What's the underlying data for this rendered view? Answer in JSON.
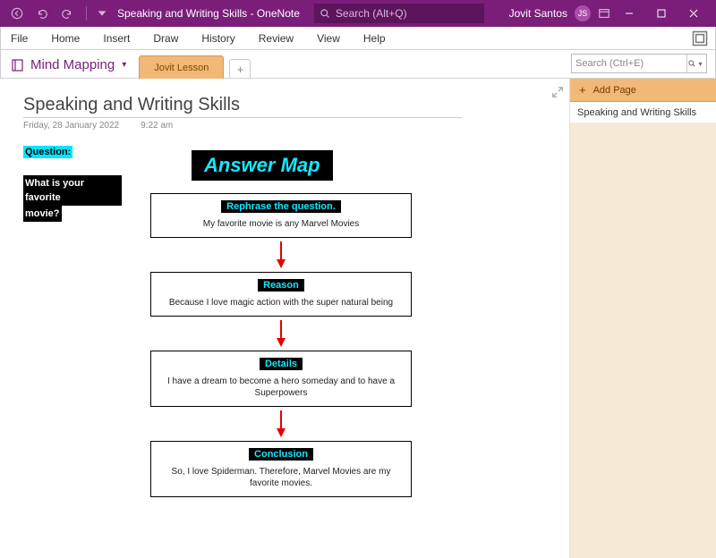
{
  "titlebar": {
    "doc_title": "Speaking and Writing Skills",
    "app_suffix": " - OneNote",
    "search_placeholder": "Search (Alt+Q)",
    "user_name": "Jovit Santos",
    "user_initials": "JS"
  },
  "ribbon": {
    "items": [
      "File",
      "Home",
      "Insert",
      "Draw",
      "History",
      "Review",
      "View",
      "Help"
    ]
  },
  "notebook": {
    "name": "Mind Mapping",
    "section_tab": "Jovit Lesson",
    "search_placeholder": "Search (Ctrl+E)"
  },
  "page": {
    "title": "Speaking and Writing Skills",
    "date": "Friday, 28 January 2022",
    "time": "9:22 am"
  },
  "content": {
    "question_label": "Question:",
    "question_text_1": "What is your favorite",
    "question_text_2": "movie?",
    "answer_map_title": "Answer Map",
    "boxes": [
      {
        "heading": "Rephrase the question.",
        "text": "My favorite movie is any Marvel Movies"
      },
      {
        "heading": "Reason",
        "text": "Because I love magic action with the super natural being"
      },
      {
        "heading": "Details",
        "text": "I have a  dream to become a hero someday and to have a Superpowers"
      },
      {
        "heading": "Conclusion",
        "text": "So, I love Spiderman. Therefore, Marvel Movies are my favorite movies."
      }
    ]
  },
  "sidepanel": {
    "add_page": "Add Page",
    "pages": [
      "Speaking and Writing Skills"
    ]
  }
}
